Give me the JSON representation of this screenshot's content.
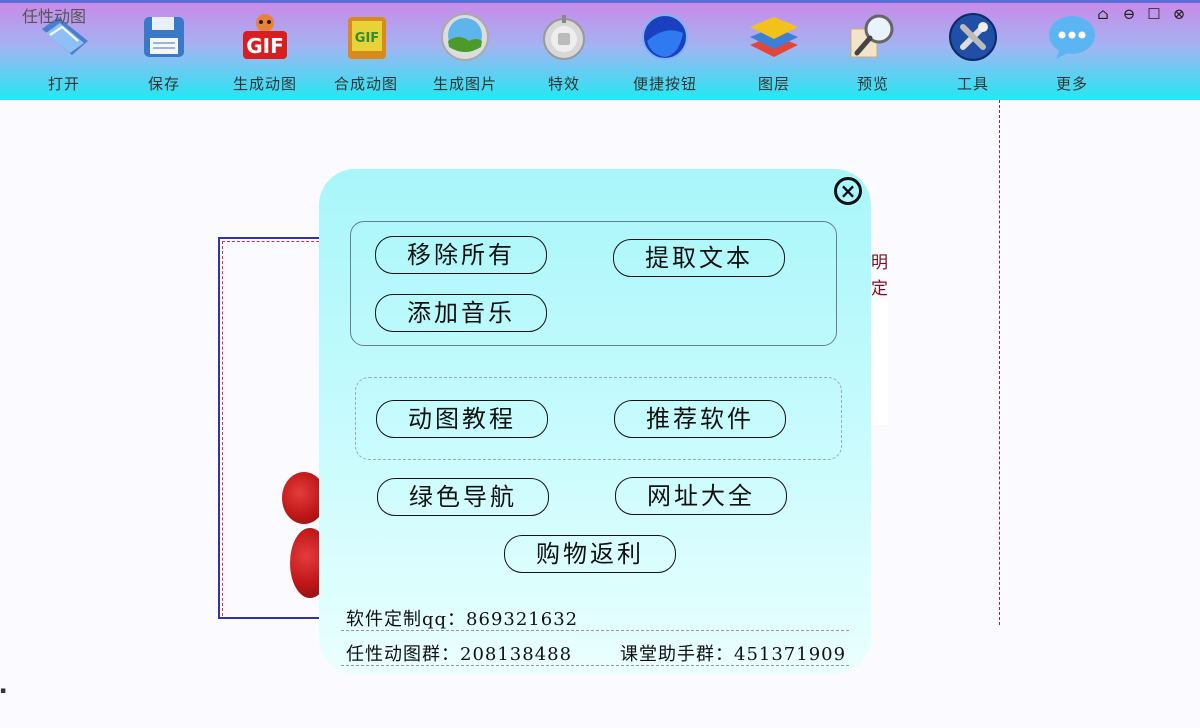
{
  "window": {
    "title": "任性动图",
    "controls": [
      "home-icon",
      "minimize-icon",
      "maximize-icon",
      "close-icon"
    ]
  },
  "toolbar": {
    "items": [
      {
        "label": "打开",
        "icon": "open-folder-icon"
      },
      {
        "label": "保存",
        "icon": "save-disk-icon"
      },
      {
        "label": "生成动图",
        "icon": "gif-make-icon"
      },
      {
        "label": "合成动图",
        "icon": "gif-merge-icon"
      },
      {
        "label": "生成图片",
        "icon": "image-icon"
      },
      {
        "label": "特效",
        "icon": "effects-icon"
      },
      {
        "label": "便捷按钮",
        "icon": "quick-button-icon"
      },
      {
        "label": "图层",
        "icon": "layers-icon"
      },
      {
        "label": "预览",
        "icon": "magnifier-icon"
      },
      {
        "label": "工具",
        "icon": "tools-icon"
      },
      {
        "label": "更多",
        "icon": "more-chat-icon"
      }
    ]
  },
  "canvas": {
    "side_text": [
      "明",
      "定"
    ]
  },
  "dialog": {
    "close_icon": "close-circle-icon",
    "buttons": {
      "remove_all": "移除所有",
      "extract_text": "提取文本",
      "add_music": "添加音乐",
      "gif_tutorial": "动图教程",
      "recommend_software": "推荐软件",
      "green_nav": "绿色导航",
      "url_collection": "网址大全",
      "shopping_rebate": "购物返利"
    },
    "info": {
      "custom_qq": "软件定制qq：869321632",
      "gif_group": "任性动图群：208138488",
      "class_group": "课堂助手群：451371909"
    }
  },
  "colors": {
    "toolbar_top": "#c98ae8",
    "toolbar_bottom": "#22e8f2",
    "dialog_bg": "#b4f8fb"
  }
}
